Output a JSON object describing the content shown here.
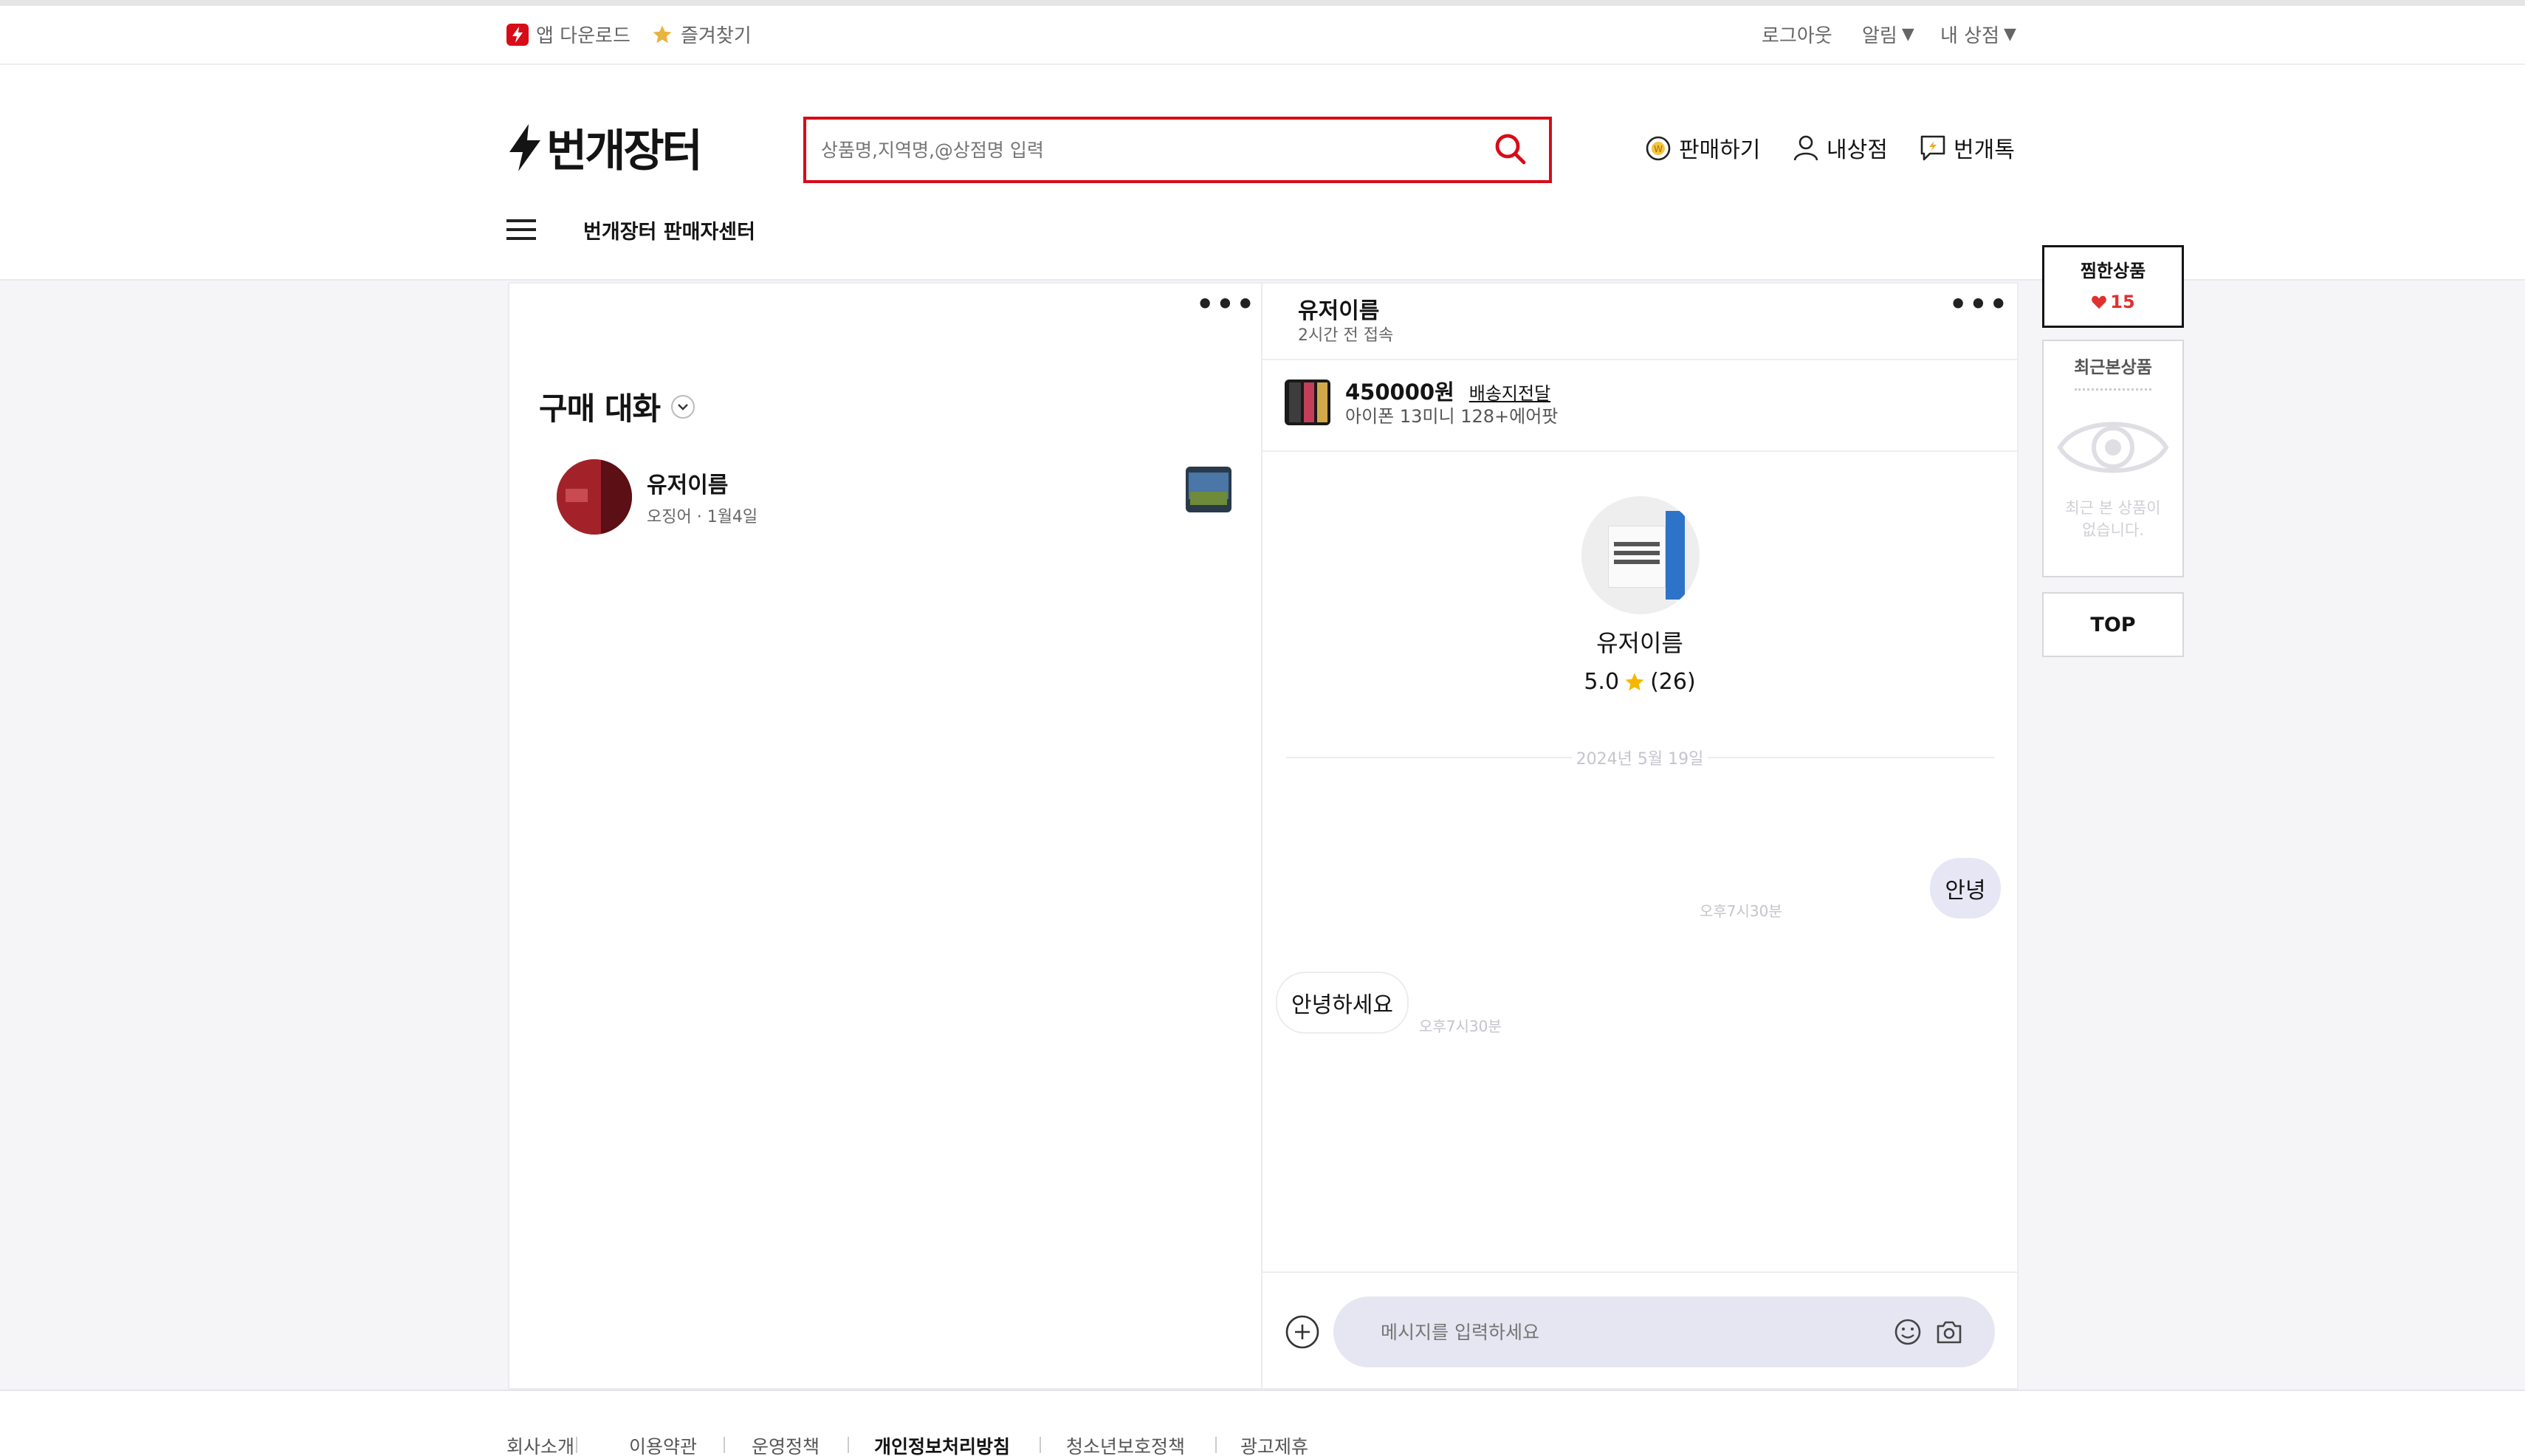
{
  "topbar": {
    "app_download": "앱 다운로드",
    "favorites": "즐겨찾기",
    "logout": "로그아웃",
    "alerts": "알림",
    "my_shop": "내 상점",
    "dropdown_caret": "▼"
  },
  "header": {
    "logo_text": "번개장터",
    "search_placeholder": "상품명,지역명,@상점명 입력",
    "sell": "판매하기",
    "my_store": "내상점",
    "talk": "번개톡",
    "seller_center": "번개장터 판매자센터"
  },
  "chat_list": {
    "title": "구매 대화",
    "items": [
      {
        "name": "유저이름",
        "meta": "오징어 · 1월4일"
      }
    ]
  },
  "chat": {
    "user_name": "유저이름",
    "last_seen": "2시간 전 접속",
    "product_price": "450000원",
    "shipping_link": "배송지전달",
    "product_name": "아이폰 13미니 128+에어팟",
    "profile_name": "유저이름",
    "rating": "5.0",
    "review_count": "(26)",
    "date_divider": "2024년 5월 19일",
    "messages": [
      {
        "from": "me",
        "text": "안녕",
        "time": "오후7시30분"
      },
      {
        "from": "other",
        "text": "안녕하세요",
        "time": "오후7시30분"
      }
    ],
    "input_placeholder": "메시지를 입력하세요"
  },
  "sidebar": {
    "wishlist_title": "찜한상품",
    "wishlist_count": "15",
    "recent_title": "최근본상품",
    "recent_empty_line1": "최근 본 상품이",
    "recent_empty_line2": "없습니다.",
    "top_button": "TOP"
  },
  "footer": {
    "links": [
      "회사소개",
      "이용약관",
      "운영정책",
      "개인정보처리방침",
      "청소년보호정책",
      "광고제휴"
    ]
  },
  "colors": {
    "brand_red": "#d80c18",
    "bubble_me": "#e6e6f5",
    "input_bg": "#e6e6f3",
    "star": "#f5b800",
    "heart": "#e03131"
  }
}
